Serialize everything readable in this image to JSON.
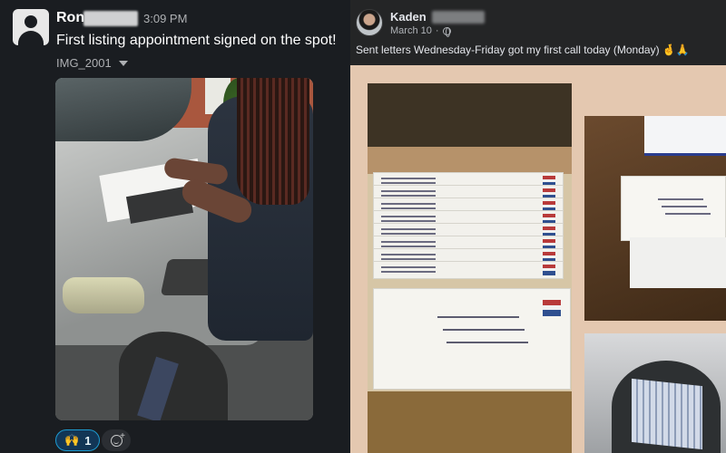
{
  "chat": {
    "sender": "Ron",
    "time": "3:09 PM",
    "message": "First listing appointment signed on the spot!",
    "attachment_name": "IMG_2001",
    "reaction": {
      "emoji": "🙌",
      "count": "1"
    },
    "colors": {
      "background": "#1a1d21",
      "reaction_border": "#1d9bd1"
    }
  },
  "post": {
    "author": "Kaden",
    "date": "March 10",
    "separator": "·",
    "caption": "Sent letters Wednesday-Friday got my first call today (Monday) 🤞🙏",
    "colors": {
      "background": "#242526",
      "photo_backdrop": "#e4c8b0"
    }
  }
}
